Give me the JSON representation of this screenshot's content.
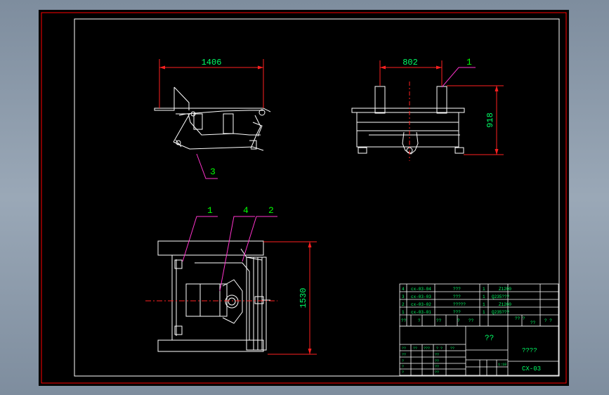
{
  "colors": {
    "outline": "#ffffff",
    "dimension": "#ff2020",
    "text_dim": "#00ff66",
    "leader": "#ff33cc",
    "frame": "#ff0000",
    "label": "#00ff00",
    "table": "#ffffff",
    "table_text": "#00ff66"
  },
  "dimensions": {
    "side_width": "1406",
    "front_width": "802",
    "front_height": "918",
    "plan_height": "1530"
  },
  "callouts": {
    "front_1": "1",
    "side_3": "3",
    "plan_1": "1",
    "plan_4": "4",
    "plan_2": "2"
  },
  "bom": {
    "rows": [
      {
        "no": "4",
        "code": "cx-03-04",
        "name": "???",
        "qty": "1",
        "material": "Z1200"
      },
      {
        "no": "3",
        "code": "cx-03-03",
        "name": "???",
        "qty": "1",
        "material": "Q235???"
      },
      {
        "no": "2",
        "code": "cx-03-02",
        "name": "?????",
        "qty": "1",
        "material": "Z1200"
      },
      {
        "no": "1",
        "code": "cx-03-01",
        "name": "???",
        "qty": "1",
        "material": "Q235???"
      }
    ],
    "header": [
      "??",
      "?",
      "??",
      "?",
      "??",
      "?? ?",
      "??",
      "? ?"
    ]
  },
  "title_block": {
    "drawing_name": "??",
    "company": "????",
    "drawing_no": "CX-03",
    "cells": [
      "??",
      "??",
      "???",
      "? ?",
      "??",
      "??",
      "??",
      "?",
      "??",
      "?",
      "??",
      "?",
      "??",
      "1:10"
    ]
  }
}
